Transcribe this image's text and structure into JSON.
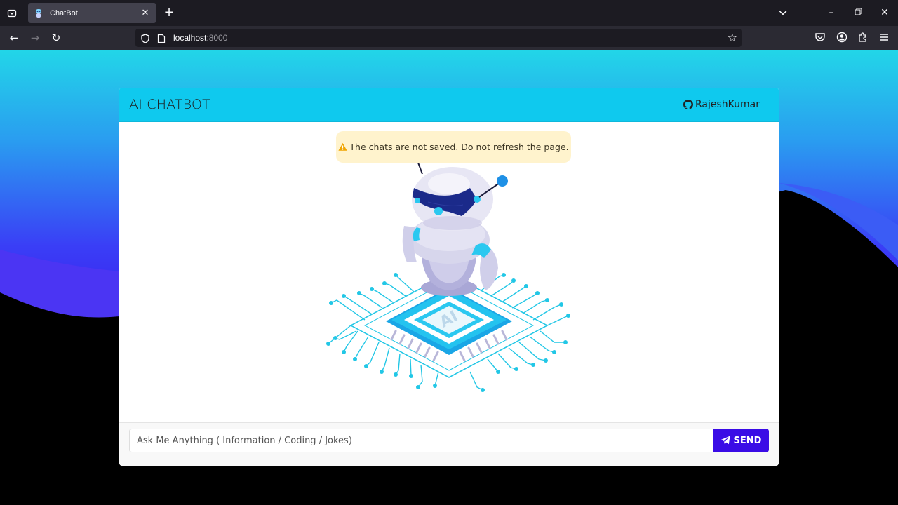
{
  "browser": {
    "tab_title": "ChatBot",
    "url_host": "localhost",
    "url_port": ":8000"
  },
  "header": {
    "brand": "AI CHATBOT",
    "github_user": "RajeshKumar"
  },
  "alert": {
    "text": "The chats are not saved. Do not refresh the page."
  },
  "illustration": {
    "chip_label": "AI"
  },
  "chat": {
    "input_placeholder": "Ask Me Anything ( Information / Coding / Jokes)",
    "send_label": "SEND"
  },
  "colors": {
    "header_bg": "#0fc9ee",
    "send_button": "#3a0ce6",
    "alert_bg": "#fff3cd",
    "background_gradient": [
      "#22d3ee",
      "#3b3df5",
      "#000000"
    ]
  },
  "icons": {
    "tab_list": "tab-list-icon",
    "favicon": "robot-favicon-icon",
    "github": "github-icon",
    "alert": "warning-icon",
    "send": "paper-plane-icon"
  }
}
